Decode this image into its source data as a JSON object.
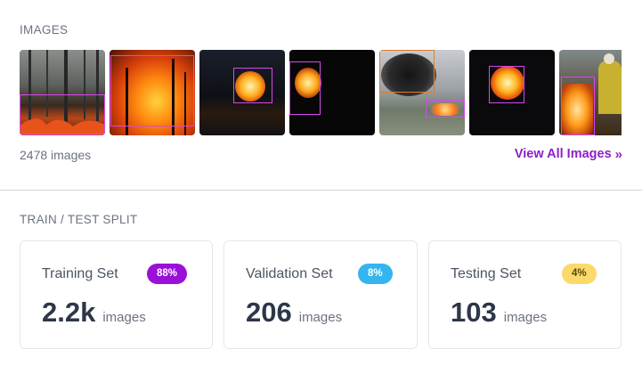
{
  "images_section": {
    "label": "IMAGES",
    "count_text": "2478 images",
    "view_all_label": "View All Images",
    "view_all_icon": "double-chevron-right-icon",
    "thumbnails": [
      {
        "subject": "forest fire at ground level"
      },
      {
        "subject": "large wildfire blaze"
      },
      {
        "subject": "burning vehicle at night"
      },
      {
        "subject": "fire in darkness"
      },
      {
        "subject": "black smoke plume"
      },
      {
        "subject": "burning car at night"
      },
      {
        "subject": "firefighters near flames"
      }
    ]
  },
  "split_section": {
    "label": "TRAIN / TEST SPLIT",
    "cards": [
      {
        "title": "Training Set",
        "badge": "88%",
        "badge_color": "#9b10d8",
        "value": "2.2k",
        "unit": "images"
      },
      {
        "title": "Validation Set",
        "badge": "8%",
        "badge_color": "#34b5ee",
        "value": "206",
        "unit": "images"
      },
      {
        "title": "Testing Set",
        "badge": "4%",
        "badge_color": "#fbd96a",
        "value": "103",
        "unit": "images"
      }
    ]
  },
  "colors": {
    "accent": "#8b1fc9",
    "bbox": "#d946ef",
    "bbox_alt": "#e07a2a"
  }
}
